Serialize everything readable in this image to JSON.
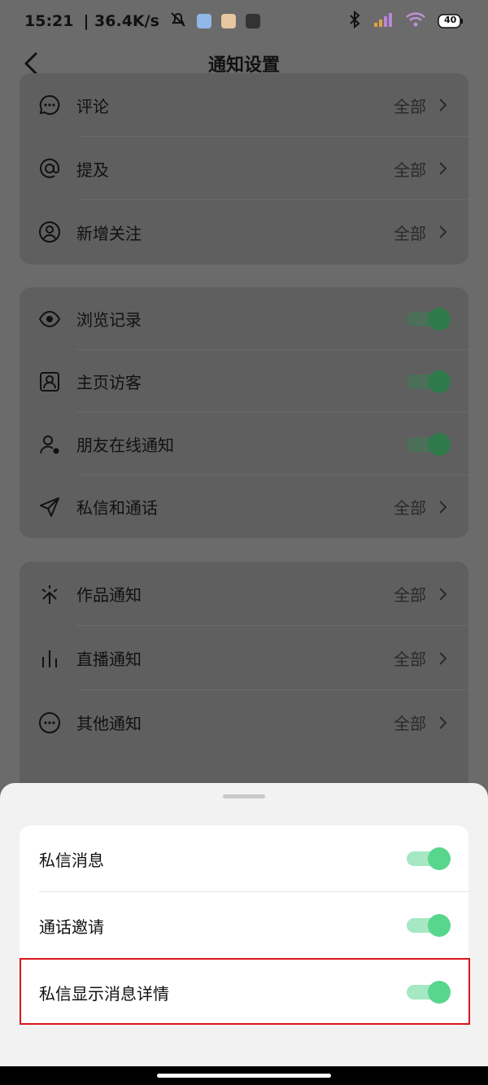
{
  "status_bar": {
    "time": "15:21",
    "net_speed": "| 36.4K/s",
    "battery": "40"
  },
  "header": {
    "title": "通知设置"
  },
  "group1": [
    {
      "label": "评论",
      "value": "全部"
    },
    {
      "label": "提及",
      "value": "全部"
    },
    {
      "label": "新增关注",
      "value": "全部"
    }
  ],
  "group2": [
    {
      "label": "浏览记录",
      "toggle": true
    },
    {
      "label": "主页访客",
      "toggle": true
    },
    {
      "label": "朋友在线通知",
      "toggle": true
    },
    {
      "label": "私信和通话",
      "value": "全部"
    }
  ],
  "group3": [
    {
      "label": "作品通知",
      "value": "全部"
    },
    {
      "label": "直播通知",
      "value": "全部"
    },
    {
      "label": "其他通知",
      "value": "全部"
    }
  ],
  "sheet": {
    "items": [
      {
        "label": "私信消息",
        "toggle": true
      },
      {
        "label": "通话邀请",
        "toggle": true
      },
      {
        "label": "私信显示消息详情",
        "toggle": true
      }
    ]
  },
  "colors": {
    "toggle_on": "#58d68d",
    "highlight": "#d9151b"
  }
}
